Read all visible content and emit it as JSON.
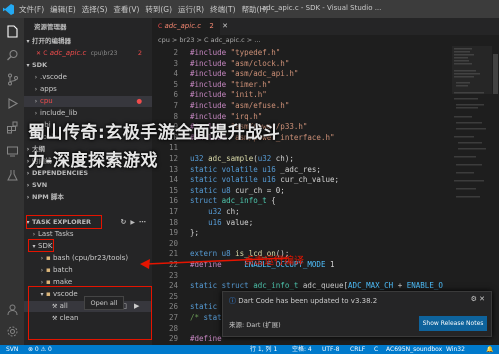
{
  "titlebar": {
    "menus": [
      "文件(F)",
      "编辑(E)",
      "选择(S)",
      "查看(V)",
      "转到(G)",
      "运行(R)",
      "终端(T)",
      "帮助(H)"
    ],
    "window_title": "adc_apic.c - SDK - Visual Studio ..."
  },
  "sidebar": {
    "title": "资源管理器",
    "open_editors": "打开的编辑器",
    "open_file": "adc_apic.c",
    "open_file_path": "cpu\\br23",
    "open_count": "2",
    "root": "SDK",
    "folders": [
      ".vscode",
      "apps",
      "cpu",
      "include_lib",
      "obj",
      "tools"
    ],
    "collapsed_sections": [
      "大纲",
      "时间线",
      "DEPENDENCIES",
      "SVN",
      "NPM 脚本"
    ],
    "task_explorer": "TASK EXPLORER",
    "last_tasks": "Last Tasks",
    "sdk": "SDK",
    "task_groups": [
      "bash (cpu/br23/tools)",
      "batch",
      "make"
    ],
    "vscode_group": "vscode",
    "vscode_tasks": [
      "all",
      "clean"
    ],
    "tooltip": "Open all"
  },
  "editor": {
    "tab_name": "adc_apic.c",
    "tab_badge": "2",
    "breadcrumb": "cpu > br23 > C adc_apic.c > ...",
    "lines": [
      {
        "n": "2",
        "t": "#include \"typedef.h\""
      },
      {
        "n": "3",
        "t": "#include \"asm/clock.h\""
      },
      {
        "n": "4",
        "t": "#include \"asm/adc_api.h\""
      },
      {
        "n": "5",
        "t": "#include \"timer.h\""
      },
      {
        "n": "6",
        "t": "#include \"init.h\""
      },
      {
        "n": "7",
        "t": "#include \"asm/efuse.h\""
      },
      {
        "n": "8",
        "t": "#include \"irq.h\""
      },
      {
        "n": "9",
        "t": "#include \"asm/power/p33.h\""
      },
      {
        "n": "10",
        "t": "#include \"asm/power_interface.h\""
      },
      {
        "n": "11",
        "t": ""
      },
      {
        "n": "12",
        "t": "u32 adc_sample(u32 ch);"
      },
      {
        "n": "13",
        "t": "static volatile u16 _adc_res;"
      },
      {
        "n": "14",
        "t": "static volatile u16 cur_ch_value;"
      },
      {
        "n": "15",
        "t": "static u8 cur_ch = 0;"
      },
      {
        "n": "16",
        "t": "struct adc_info_t {"
      },
      {
        "n": "17",
        "t": "    u32 ch;"
      },
      {
        "n": "18",
        "t": "    u16 value;"
      },
      {
        "n": "19",
        "t": "};"
      },
      {
        "n": "20",
        "t": ""
      },
      {
        "n": "21",
        "t": "extern u8 is_lcd_on();"
      },
      {
        "n": "22",
        "t": "#define     ENABLE_OCCUPY_MODE 1"
      },
      {
        "n": "23",
        "t": ""
      },
      {
        "n": "24",
        "t": "static struct adc_info_t adc_queue[ADC_MAX_CH + ENABLE_O"
      },
      {
        "n": "25",
        "t": ""
      },
      {
        "n": "26",
        "t": "static u16 vbg_"
      },
      {
        "n": "27",
        "t": "/* static u1"
      },
      {
        "n": "28",
        "t": ""
      },
      {
        "n": "29",
        "t": "#define"
      }
    ]
  },
  "watermark": {
    "line1": "蜀山传奇:玄极手游全面提升战斗",
    "line2": "力-深度探索游戏"
  },
  "annotation": {
    "text": "点击运行编译"
  },
  "notification": {
    "message": "Dart Code has been updated to v3.38.2",
    "source": "来源: Dart (扩展)",
    "button": "Show Release Notes"
  },
  "statusbar": {
    "items": [
      "SVN",
      "⊗ 0 ⚠ 0",
      "行 1, 列 1",
      "空格: 4",
      "UTF-8",
      "CRLF",
      "C",
      "AC695N_soundbox",
      "Win32"
    ]
  },
  "colors": {
    "accent": "#007acc",
    "annotation_red": "#e51400"
  }
}
